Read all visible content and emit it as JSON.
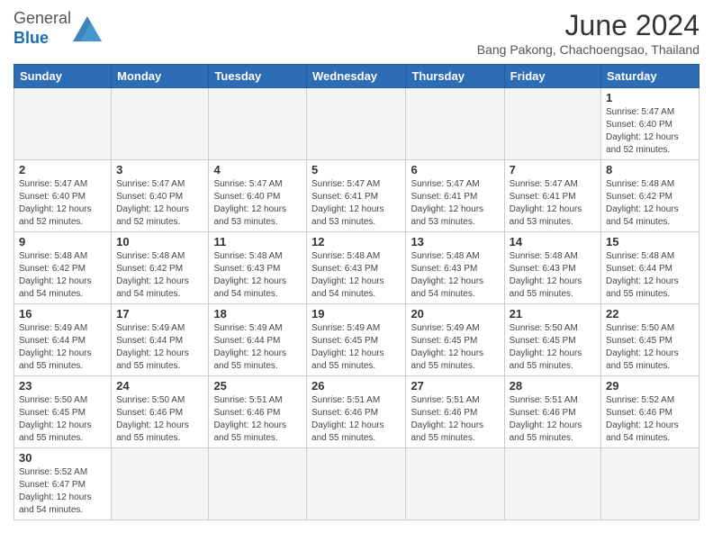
{
  "header": {
    "logo_general": "General",
    "logo_blue": "Blue",
    "month_title": "June 2024",
    "location": "Bang Pakong, Chachoengsao, Thailand"
  },
  "days_of_week": [
    "Sunday",
    "Monday",
    "Tuesday",
    "Wednesday",
    "Thursday",
    "Friday",
    "Saturday"
  ],
  "weeks": [
    [
      {
        "day": "",
        "info": "",
        "empty": true
      },
      {
        "day": "",
        "info": "",
        "empty": true
      },
      {
        "day": "",
        "info": "",
        "empty": true
      },
      {
        "day": "",
        "info": "",
        "empty": true
      },
      {
        "day": "",
        "info": "",
        "empty": true
      },
      {
        "day": "",
        "info": "",
        "empty": true
      },
      {
        "day": "1",
        "info": "Sunrise: 5:47 AM\nSunset: 6:40 PM\nDaylight: 12 hours\nand 52 minutes.",
        "empty": false
      }
    ],
    [
      {
        "day": "2",
        "info": "Sunrise: 5:47 AM\nSunset: 6:40 PM\nDaylight: 12 hours\nand 52 minutes.",
        "empty": false
      },
      {
        "day": "3",
        "info": "Sunrise: 5:47 AM\nSunset: 6:40 PM\nDaylight: 12 hours\nand 52 minutes.",
        "empty": false
      },
      {
        "day": "4",
        "info": "Sunrise: 5:47 AM\nSunset: 6:40 PM\nDaylight: 12 hours\nand 53 minutes.",
        "empty": false
      },
      {
        "day": "5",
        "info": "Sunrise: 5:47 AM\nSunset: 6:41 PM\nDaylight: 12 hours\nand 53 minutes.",
        "empty": false
      },
      {
        "day": "6",
        "info": "Sunrise: 5:47 AM\nSunset: 6:41 PM\nDaylight: 12 hours\nand 53 minutes.",
        "empty": false
      },
      {
        "day": "7",
        "info": "Sunrise: 5:47 AM\nSunset: 6:41 PM\nDaylight: 12 hours\nand 53 minutes.",
        "empty": false
      },
      {
        "day": "8",
        "info": "Sunrise: 5:48 AM\nSunset: 6:42 PM\nDaylight: 12 hours\nand 54 minutes.",
        "empty": false
      }
    ],
    [
      {
        "day": "9",
        "info": "Sunrise: 5:48 AM\nSunset: 6:42 PM\nDaylight: 12 hours\nand 54 minutes.",
        "empty": false
      },
      {
        "day": "10",
        "info": "Sunrise: 5:48 AM\nSunset: 6:42 PM\nDaylight: 12 hours\nand 54 minutes.",
        "empty": false
      },
      {
        "day": "11",
        "info": "Sunrise: 5:48 AM\nSunset: 6:43 PM\nDaylight: 12 hours\nand 54 minutes.",
        "empty": false
      },
      {
        "day": "12",
        "info": "Sunrise: 5:48 AM\nSunset: 6:43 PM\nDaylight: 12 hours\nand 54 minutes.",
        "empty": false
      },
      {
        "day": "13",
        "info": "Sunrise: 5:48 AM\nSunset: 6:43 PM\nDaylight: 12 hours\nand 54 minutes.",
        "empty": false
      },
      {
        "day": "14",
        "info": "Sunrise: 5:48 AM\nSunset: 6:43 PM\nDaylight: 12 hours\nand 55 minutes.",
        "empty": false
      },
      {
        "day": "15",
        "info": "Sunrise: 5:48 AM\nSunset: 6:44 PM\nDaylight: 12 hours\nand 55 minutes.",
        "empty": false
      }
    ],
    [
      {
        "day": "16",
        "info": "Sunrise: 5:49 AM\nSunset: 6:44 PM\nDaylight: 12 hours\nand 55 minutes.",
        "empty": false
      },
      {
        "day": "17",
        "info": "Sunrise: 5:49 AM\nSunset: 6:44 PM\nDaylight: 12 hours\nand 55 minutes.",
        "empty": false
      },
      {
        "day": "18",
        "info": "Sunrise: 5:49 AM\nSunset: 6:44 PM\nDaylight: 12 hours\nand 55 minutes.",
        "empty": false
      },
      {
        "day": "19",
        "info": "Sunrise: 5:49 AM\nSunset: 6:45 PM\nDaylight: 12 hours\nand 55 minutes.",
        "empty": false
      },
      {
        "day": "20",
        "info": "Sunrise: 5:49 AM\nSunset: 6:45 PM\nDaylight: 12 hours\nand 55 minutes.",
        "empty": false
      },
      {
        "day": "21",
        "info": "Sunrise: 5:50 AM\nSunset: 6:45 PM\nDaylight: 12 hours\nand 55 minutes.",
        "empty": false
      },
      {
        "day": "22",
        "info": "Sunrise: 5:50 AM\nSunset: 6:45 PM\nDaylight: 12 hours\nand 55 minutes.",
        "empty": false
      }
    ],
    [
      {
        "day": "23",
        "info": "Sunrise: 5:50 AM\nSunset: 6:45 PM\nDaylight: 12 hours\nand 55 minutes.",
        "empty": false
      },
      {
        "day": "24",
        "info": "Sunrise: 5:50 AM\nSunset: 6:46 PM\nDaylight: 12 hours\nand 55 minutes.",
        "empty": false
      },
      {
        "day": "25",
        "info": "Sunrise: 5:51 AM\nSunset: 6:46 PM\nDaylight: 12 hours\nand 55 minutes.",
        "empty": false
      },
      {
        "day": "26",
        "info": "Sunrise: 5:51 AM\nSunset: 6:46 PM\nDaylight: 12 hours\nand 55 minutes.",
        "empty": false
      },
      {
        "day": "27",
        "info": "Sunrise: 5:51 AM\nSunset: 6:46 PM\nDaylight: 12 hours\nand 55 minutes.",
        "empty": false
      },
      {
        "day": "28",
        "info": "Sunrise: 5:51 AM\nSunset: 6:46 PM\nDaylight: 12 hours\nand 55 minutes.",
        "empty": false
      },
      {
        "day": "29",
        "info": "Sunrise: 5:52 AM\nSunset: 6:46 PM\nDaylight: 12 hours\nand 54 minutes.",
        "empty": false
      }
    ],
    [
      {
        "day": "30",
        "info": "Sunrise: 5:52 AM\nSunset: 6:47 PM\nDaylight: 12 hours\nand 54 minutes.",
        "empty": false
      },
      {
        "day": "",
        "info": "",
        "empty": true
      },
      {
        "day": "",
        "info": "",
        "empty": true
      },
      {
        "day": "",
        "info": "",
        "empty": true
      },
      {
        "day": "",
        "info": "",
        "empty": true
      },
      {
        "day": "",
        "info": "",
        "empty": true
      },
      {
        "day": "",
        "info": "",
        "empty": true
      }
    ]
  ]
}
